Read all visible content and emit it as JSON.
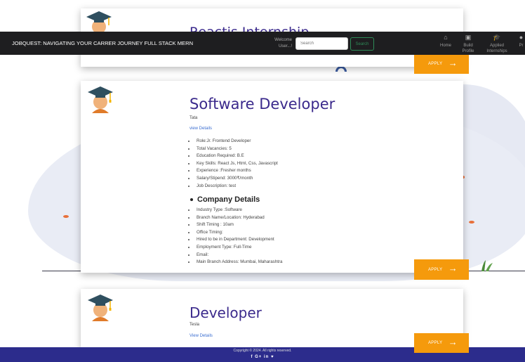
{
  "navbar": {
    "brand": "JOBQUEST: NAVIGATING YOUR CARRER JOURNEY FULL STACK MERN",
    "welcome_line1": "Welcome",
    "welcome_line2": "User...!",
    "search_placeholder": "Search",
    "search_button": "Search",
    "items": [
      {
        "label": "Home",
        "icon": "home-icon"
      },
      {
        "label": "Build Profile",
        "icon": "id-card-icon"
      },
      {
        "label": "Applied Internships",
        "icon": "graduation-cap-icon"
      },
      {
        "label": "Pr",
        "icon": "user-icon"
      }
    ]
  },
  "cards": [
    {
      "title": "Reactjs Internship",
      "apply_label": "APPLY"
    },
    {
      "title": "Software Developer",
      "company": "Tata",
      "view_details": "view Details",
      "details": [
        "Role:Jr. Frontend Developer",
        "Total Vacancies: 5",
        "Education Required: B.E",
        "Key Skills: React Js, Html, Css, Javascript",
        "Experience :Fresher months",
        "Salary/Stipend: 3000₹/month",
        "Job Description: test"
      ],
      "company_section_title": "Company Details",
      "company_details": [
        "Industry Type :Software",
        "Branch Name/Location: Hyderabad",
        "Shift Timing : 10am",
        "Office Timing:",
        "Hired to be in Department: Development",
        "Employment Type: Full-Time",
        "Email:",
        "Main Branch Address: Mumbai, Maharashtra"
      ],
      "apply_label": "APPLY"
    },
    {
      "title": "Developer",
      "company": "Tesla",
      "view_details": "View Details",
      "apply_label": "APPLY"
    }
  ],
  "footer": {
    "copyright": "Copyright © 2024. All rights reserved.",
    "social": "f G+ in ♥"
  },
  "colors": {
    "navbar_bg": "#1e1e20",
    "title": "#3b2a8c",
    "apply_button": "#f59a0c",
    "footer_bg": "#2c2c8c",
    "link": "#3c6fd1"
  }
}
